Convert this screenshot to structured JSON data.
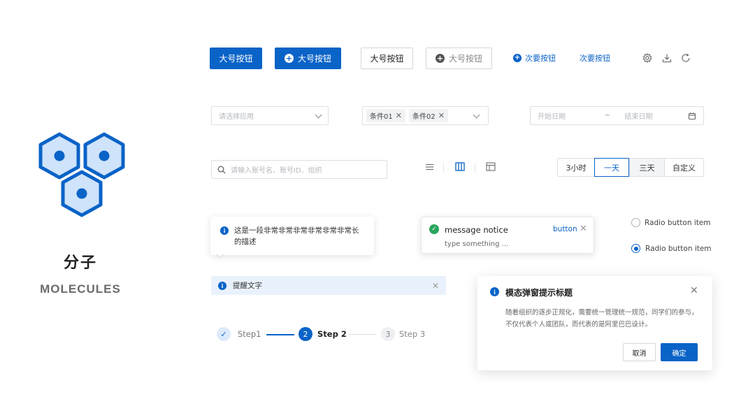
{
  "brand": {
    "title": "分子",
    "subtitle": "MOLECULES",
    "logo_icon": "hexagon-molecule-icon",
    "color": "#0a63c7"
  },
  "buttons": {
    "primary": "大号按钮",
    "primary_icon": "大号按钮",
    "default": "大号按钮",
    "disabled_icon": "大号按钮",
    "secondary_icon": "次要按钮",
    "secondary": "次要按钮"
  },
  "toolbar_icons": [
    "gear-icon",
    "download-icon",
    "refresh-icon"
  ],
  "selects": {
    "app_placeholder": "请选择应用",
    "tags": [
      "条件01",
      "条件02"
    ],
    "date_start": "开始日期",
    "date_sep": "~",
    "date_end": "结束日期"
  },
  "search": {
    "placeholder": "请输入账号名、账号ID、组织"
  },
  "view_icons": [
    "list-view-icon",
    "column-view-icon",
    "layout-view-icon"
  ],
  "segmented": {
    "items": [
      "3小时",
      "一天",
      "三天",
      "自定义"
    ],
    "selected": "一天"
  },
  "tooltip": {
    "text": "这是一段非常非常非常非常非常非常长的描述"
  },
  "notice": {
    "title": "message notice",
    "action": "button",
    "body": "type something ..."
  },
  "radios": [
    {
      "label": "Radio button item",
      "checked": false
    },
    {
      "label": "Radio button item",
      "checked": true
    }
  ],
  "alert": {
    "text": "提醒文字"
  },
  "steps": [
    {
      "label": "Step1",
      "state": "done"
    },
    {
      "label": "Step 2",
      "number": "2",
      "state": "current"
    },
    {
      "label": "Step 3",
      "number": "3",
      "state": "todo"
    }
  ],
  "modal": {
    "title": "模态弹窗提示标题",
    "body": "随着组织的逐步正规化，需要统一管理统一规范，同学们的参与，不仅代表个人或团队，而代表的是阿里巴巴设计。",
    "cancel": "取消",
    "confirm": "确定"
  }
}
